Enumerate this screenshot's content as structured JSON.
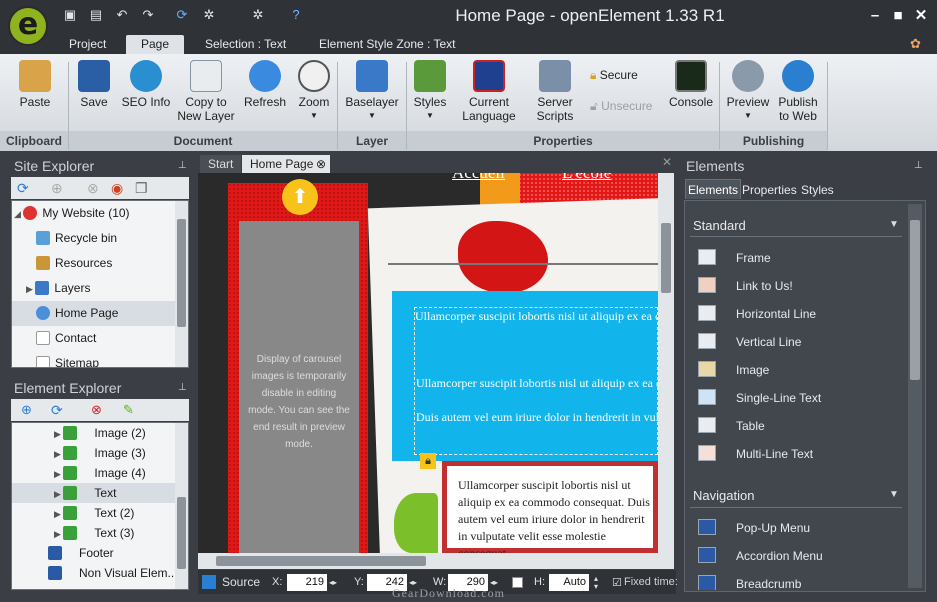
{
  "window": {
    "title": "Home Page - openElement 1.33 R1"
  },
  "titlebar": {
    "logo_letter": "e"
  },
  "tabs": [
    "Project",
    "Page",
    "Selection : Text",
    "Element Style Zone : Text"
  ],
  "ribbon": {
    "clipboard": {
      "paste": "Paste",
      "group": "Clipboard"
    },
    "document": {
      "save": "Save",
      "seo": "SEO Info",
      "copy": "Copy to New Layer",
      "refresh": "Refresh",
      "zoom": "Zoom",
      "group": "Document"
    },
    "layer": {
      "baselayer": "Baselayer",
      "group": "Layer"
    },
    "properties": {
      "styles": "Styles",
      "language": "Current Language",
      "scripts": "Server Scripts",
      "secure": "Secure",
      "unsecure": "Unsecure",
      "console": "Console",
      "group": "Properties"
    },
    "publishing": {
      "preview": "Preview",
      "publish": "Publish to Web",
      "group": "Publishing"
    }
  },
  "site_explorer": {
    "title": "Site Explorer",
    "items": [
      "My Website (10)",
      "Recycle bin",
      "Resources",
      "Layers",
      "Home Page",
      "Contact",
      "Sitemap"
    ]
  },
  "element_explorer": {
    "title": "Element Explorer",
    "items": [
      "Image (2)",
      "Image (3)",
      "Image (4)",
      "Text",
      "Text (2)",
      "Text (3)",
      "Footer",
      "Non Visual Elem..."
    ]
  },
  "doc_tabs": [
    "Start",
    "Home Page"
  ],
  "canvas": {
    "nav": [
      "Accueil",
      "L'école"
    ],
    "carousel_note": "Display of carousel images is temporarily disable in editing mode. You can see the end result in preview mode.",
    "para1": "Ullamcorper suscipit lobortis nisl ut aliquip ex ea commodo consequat. Duis autem vel eum iriure dolor in hendrerit in vulputate velit esse molestie consequat.",
    "para2": "Ullamcorper suscipit lobortis nisl ut aliquip ex ea commodo consequat.",
    "para3": "Duis autem vel eum iriure dolor in hendrerit in vulputate velit esse molestie consequat.",
    "para4": "Ullamcorper suscipit lobortis nisl ut aliquip ex ea commodo consequat. Duis autem vel eum iriure dolor in hendrerit in vulputate velit esse molestie consequat"
  },
  "status": {
    "source": "Source",
    "x_label": "X:",
    "x": "219",
    "y_label": "Y:",
    "y": "242",
    "w_label": "W:",
    "w": "290",
    "h_label": "H:",
    "h": "Auto",
    "fixed": "Fixed time:"
  },
  "elements_panel": {
    "title": "Elements",
    "tabs": [
      "Elements",
      "Properties",
      "Styles"
    ],
    "standard_title": "Standard",
    "standard": [
      "Frame",
      "Link to Us!",
      "Horizontal Line",
      "Vertical Line",
      "Image",
      "Single-Line Text",
      "Table",
      "Multi-Line Text"
    ],
    "navigation_title": "Navigation",
    "navigation": [
      "Pop-Up Menu",
      "Accordion Menu",
      "Breadcrumb"
    ]
  },
  "watermark": "GearDownload.com"
}
